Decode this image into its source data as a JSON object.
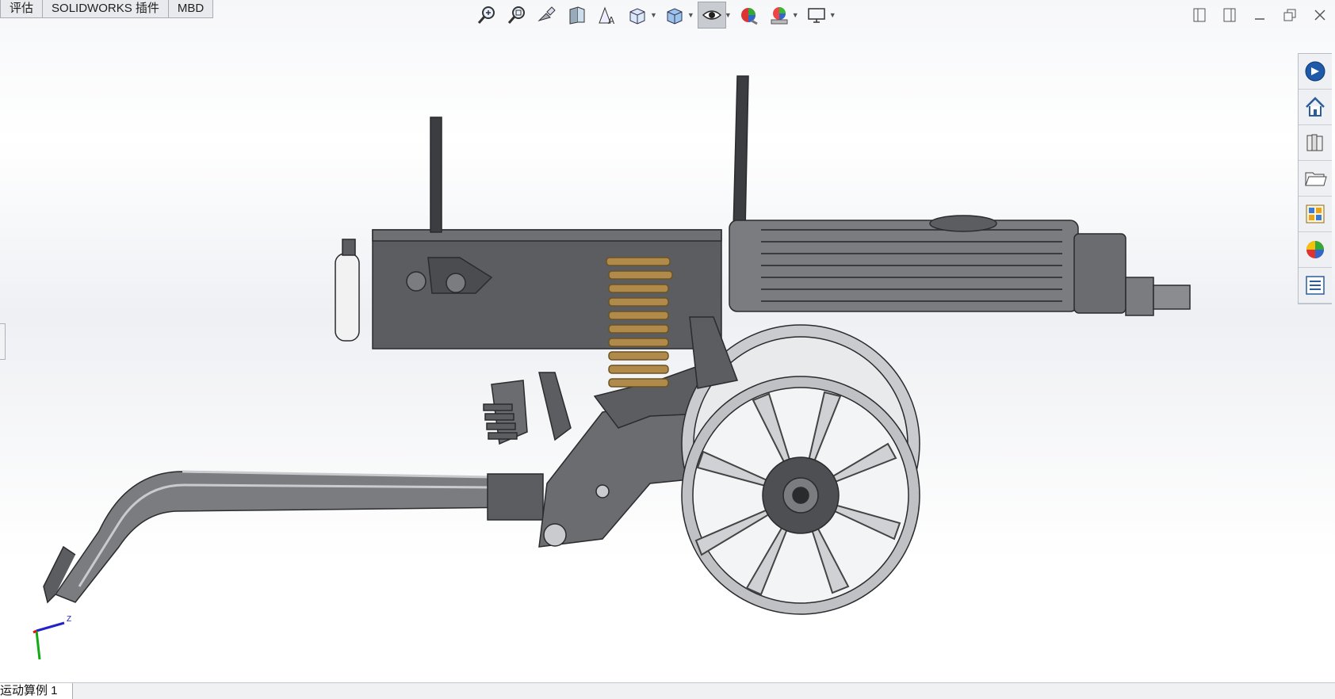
{
  "tabs": [
    {
      "label": "评估"
    },
    {
      "label": "SOLIDWORKS 插件"
    },
    {
      "label": "MBD"
    }
  ],
  "view_toolbar": [
    {
      "icon": "zoom-to-fit-icon"
    },
    {
      "icon": "zoom-to-area-icon"
    },
    {
      "icon": "previous-view-icon"
    },
    {
      "icon": "section-view-icon"
    },
    {
      "icon": "dynamic-annotation-views-icon"
    },
    {
      "icon": "view-orientation-icon"
    },
    {
      "icon": "display-style-icon"
    },
    {
      "icon": "hide-show-items-icon",
      "active": true
    },
    {
      "icon": "edit-appearance-icon"
    },
    {
      "icon": "apply-scene-icon"
    },
    {
      "icon": "view-settings-icon"
    }
  ],
  "window_controls": [
    "tile-left-icon",
    "tile-right-icon",
    "minimize-icon",
    "restore-icon",
    "close-icon"
  ],
  "task_pane": [
    {
      "icon": "solidworks-resources-icon"
    },
    {
      "icon": "home-icon"
    },
    {
      "icon": "design-library-icon"
    },
    {
      "icon": "file-explorer-icon"
    },
    {
      "icon": "view-palette-icon"
    },
    {
      "icon": "appearances-scenes-icon"
    },
    {
      "icon": "custom-properties-icon"
    }
  ],
  "triad": {
    "axis_label": "Z"
  },
  "bottom_tab": {
    "label": "运动算例 1"
  },
  "model": {
    "description_icon": "maxim-machine-gun-model"
  },
  "colors": {
    "metal_dark": "#5b5d61",
    "metal_mid": "#7a7c80",
    "metal_light": "#c9cbce",
    "brass": "#b08a4a",
    "triad_x": "#d11",
    "triad_y": "#1a1",
    "triad_z": "#22c"
  }
}
